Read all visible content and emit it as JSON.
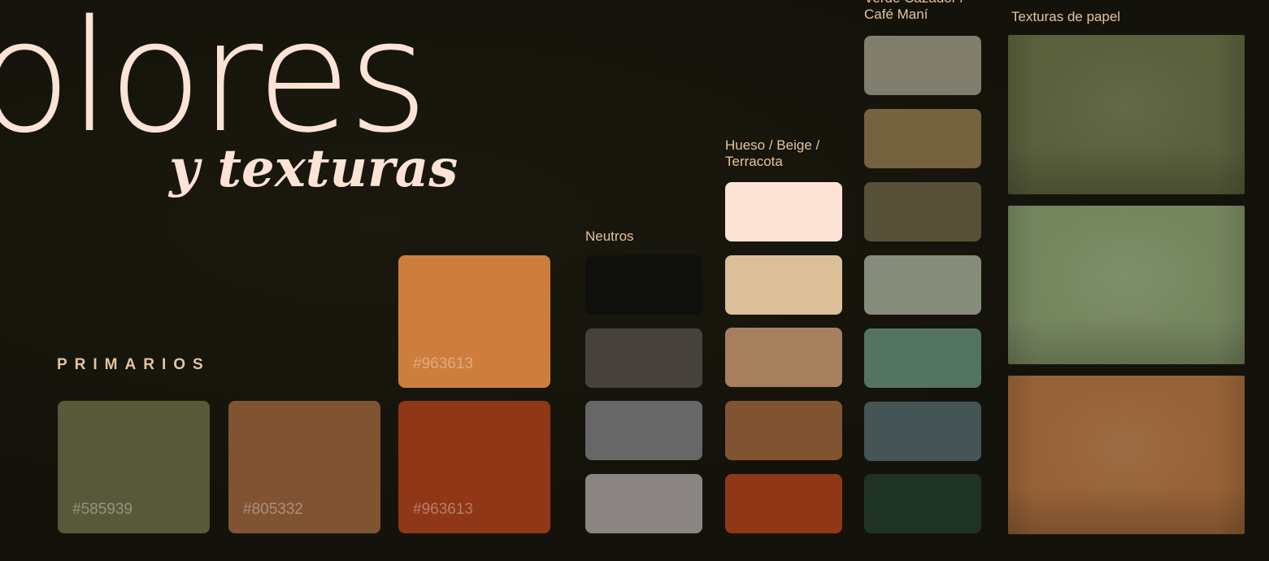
{
  "title": {
    "main": "olores",
    "sub": "y texturas"
  },
  "primarios": {
    "label": "PRIMARIOS",
    "swatches": [
      {
        "hex": "#585939",
        "color": "#585939"
      },
      {
        "hex": "#805332",
        "color": "#805332"
      },
      {
        "hex": "#963613",
        "color": "#8f3716"
      },
      {
        "hex": "#963613",
        "color": "#cd7e3c"
      }
    ]
  },
  "neutros": {
    "label": "Neutros",
    "colors": [
      "#0f100d",
      "#46413d",
      "#676767",
      "#8a8483"
    ]
  },
  "hueso": {
    "label_line1": "Hueso / Beige /",
    "label_line2": "Terracota",
    "colors": [
      "#fde3d6",
      "#dbbf99",
      "#a6805e",
      "#805433",
      "#8f3716"
    ]
  },
  "verde": {
    "label_line1": "Verde Cazador /",
    "label_line2": "Café Maní",
    "colors": [
      "#817e6d",
      "#75623f",
      "#565138",
      "#868c7b",
      "#547462",
      "#455556",
      "#1f3226"
    ]
  },
  "texturas": {
    "label": "Texturas de papel",
    "colors": [
      "#5a5f3c",
      "#76875f",
      "#976237"
    ]
  }
}
